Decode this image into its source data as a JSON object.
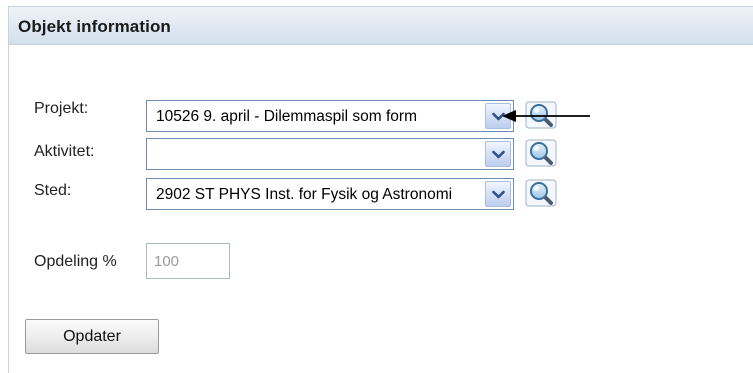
{
  "panel": {
    "title": "Objekt information"
  },
  "form": {
    "projekt": {
      "label": "Projekt:",
      "value": "10526 9. april - Dilemmaspil som form"
    },
    "aktivitet": {
      "label": "Aktivitet:",
      "value": ""
    },
    "sted": {
      "label": "Sted:",
      "value": "2902 ST PHYS Inst. for Fysik og Astronomi"
    },
    "opdeling": {
      "label": "Opdeling %",
      "value": "100"
    }
  },
  "actions": {
    "update_label": "Opdater"
  },
  "icons": {
    "dropdown": "chevron-down-icon",
    "lookup": "magnifier-icon",
    "annotation": "arrow-left-icon"
  },
  "colors": {
    "header_bg": "#dfe8f2",
    "select_border": "#6f8db3",
    "arrow_button": "#cfdcf5",
    "chevron": "#2f4f8a"
  }
}
